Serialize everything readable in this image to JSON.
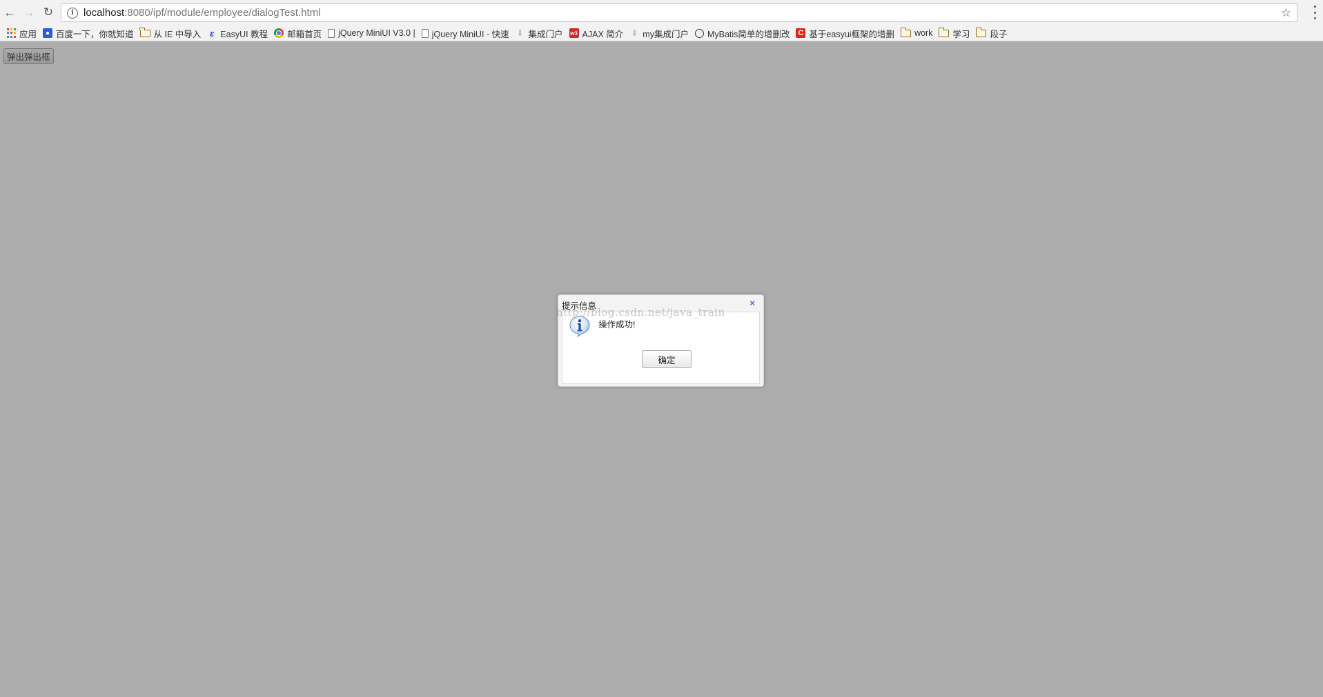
{
  "browser": {
    "url_host": "localhost",
    "url_rest": ":8080/ipf/module/employee/dialogTest.html",
    "bookmarks": [
      {
        "label": "应用",
        "icon": "apps-grid-icon"
      },
      {
        "label": "百度一下，你就知道",
        "icon": "baidu-paw-icon"
      },
      {
        "label": "从 IE 中导入",
        "icon": "folder-icon"
      },
      {
        "label": "EasyUI 教程",
        "icon": "easyui-icon"
      },
      {
        "label": "邮箱首页",
        "icon": "chrome-icon"
      },
      {
        "label": "jQuery MiniUI V3.0 |",
        "icon": "page-icon"
      },
      {
        "label": "jQuery MiniUI - 快速",
        "icon": "page-icon"
      },
      {
        "label": "集成门户",
        "icon": "download-icon"
      },
      {
        "label": "AJAX 简介",
        "icon": "w3-icon"
      },
      {
        "label": "my集成门户",
        "icon": "download-icon"
      },
      {
        "label": "MyBatis简单的增删改",
        "icon": "github-icon"
      },
      {
        "label": "基于easyui框架的增删",
        "icon": "csdn-icon"
      },
      {
        "label": "work",
        "icon": "folder-icon"
      },
      {
        "label": "学习",
        "icon": "folder-icon"
      },
      {
        "label": "段子",
        "icon": "folder-icon"
      }
    ]
  },
  "page": {
    "popup_button_label": "弹出弹出框"
  },
  "dialog": {
    "title": "提示信息",
    "close_glyph": "×",
    "message": "操作成功!",
    "ok_label": "确定",
    "icon": "info-icon"
  },
  "watermark": "http://blog.csdn.net/java_train"
}
